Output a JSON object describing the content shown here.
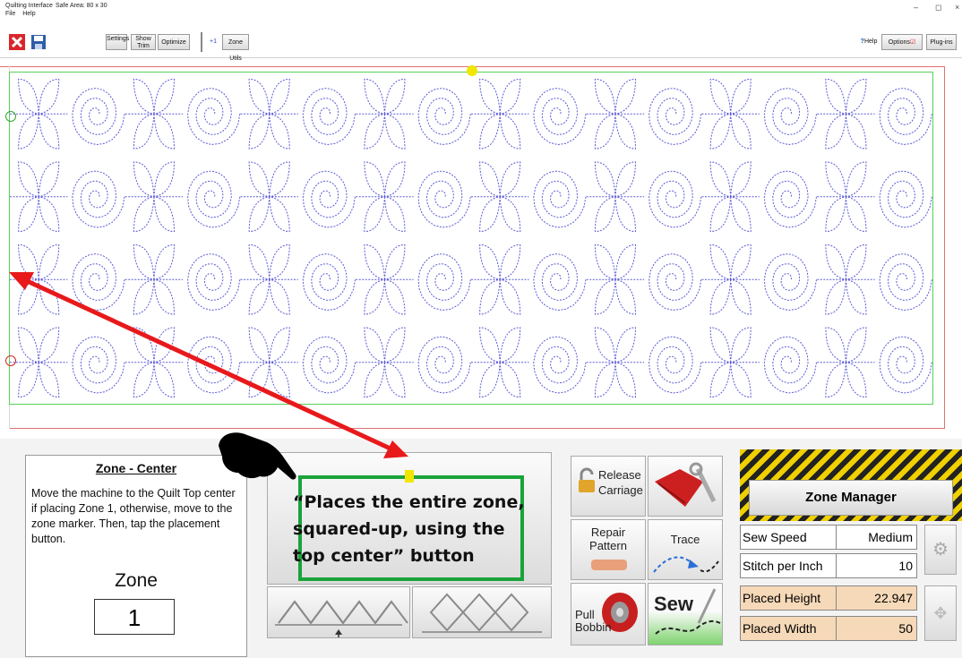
{
  "window": {
    "app_title": "Quilting Interface",
    "safe_area": "Safe Area: 80 x 30",
    "menu": [
      "File",
      "Help"
    ],
    "minimize": "–",
    "restore": "◻",
    "close": "×"
  },
  "toolbar": {
    "settings_label": "Settings",
    "show_trim_label": "Show Trim",
    "optimize_label": "Optimize",
    "plus_one_label": "+1",
    "zone_utils_label": "Zone Utils",
    "help_label": "Help",
    "options_label": "Options",
    "plugins_label": "Plug-ins"
  },
  "colors": {
    "pattern_stroke": "#5a5ad6",
    "boundary_green": "#58d058",
    "arrow_red": "#e8191b",
    "callout_green": "#1aa33a",
    "marker_yellow": "#f2e600",
    "table_highlight": "#f6d9b8"
  },
  "info_panel": {
    "title": "Zone - Center",
    "body": "Move the machine to the Quilt Top center if placing Zone 1, otherwise, move to the zone marker. Then, tap the placement button.",
    "zone_label": "Zone",
    "zone_value": "1"
  },
  "callout": {
    "line1": "“Places the entire zone,",
    "line2": "squared-up, using the",
    "line3": "top center” button"
  },
  "actions": {
    "release_carriage_1": "Release",
    "release_carriage_2": "Carriage",
    "repair_pattern_1": "Repair",
    "repair_pattern_2": "Pattern",
    "trace": "Trace",
    "pull_bobbin_1": "Pull",
    "pull_bobbin_2": "Bobbin",
    "sew": "Sew"
  },
  "zone_manager": {
    "title": "Zone Manager",
    "rows": [
      {
        "label": "Sew Speed",
        "value": "Medium"
      },
      {
        "label": "Stitch per Inch",
        "value": "10"
      },
      {
        "label": "Placed Height",
        "value": "22.947"
      },
      {
        "label": "Placed Width",
        "value": "50"
      }
    ]
  }
}
